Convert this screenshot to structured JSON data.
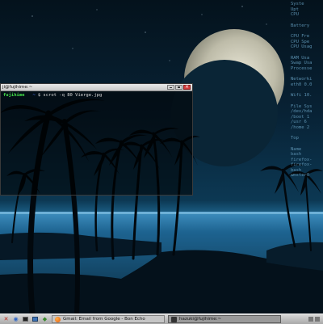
{
  "conky": {
    "lines": [
      "Syste",
      "Upt",
      "CPU",
      "",
      "Battery",
      "",
      "CPU Fre",
      "CPU Spe",
      "CPU Usag",
      "",
      "RAM Usa",
      "Swap Usa",
      "Processe",
      "",
      "Networki",
      "eth0 0.0",
      "",
      "Wifi 10.",
      "",
      "File Sys",
      "/dev/hda",
      "/boot 1",
      "/usr 6",
      "/home 2",
      "",
      "Top",
      "",
      "Name",
      "bash",
      "firefox-",
      "firefox-",
      "bash",
      "wmster0"
    ]
  },
  "terminal": {
    "title": "ji@fujihime:~",
    "prompt_user": "fujihime",
    "prompt_dir": "~",
    "command": "$ scrot -q 80 Vierge.jpg"
  },
  "taskbar": {
    "tasks": [
      {
        "label": "Gmail: Email from Google - Bon Echo"
      },
      {
        "label": "hazuki@fujihime:~"
      }
    ]
  }
}
